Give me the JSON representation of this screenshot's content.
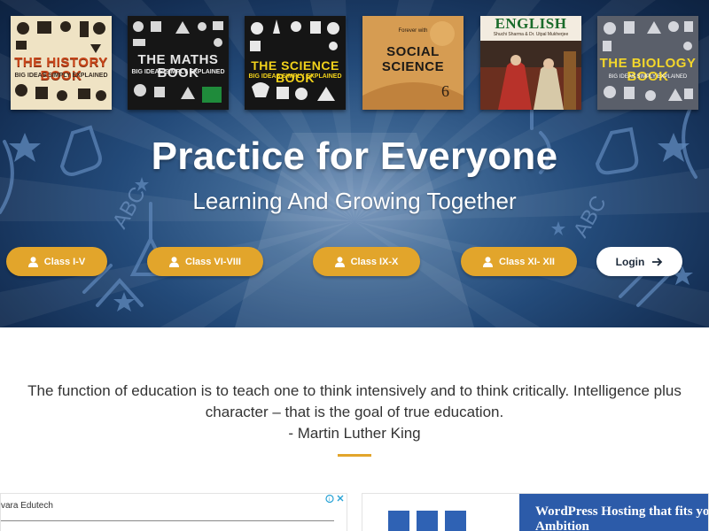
{
  "books": [
    {
      "title": "THE HISTORY BOOK",
      "subtitle": "BIG IDEAS SIMPLY EXPLAINED"
    },
    {
      "title": "THE MATHS BOOK",
      "subtitle": "BIG IDEAS SIMPLY EXPLAINED"
    },
    {
      "title": "THE SCIENCE BOOK",
      "subtitle": "BIG IDEAS SIMPLY EXPLAINED"
    },
    {
      "title": "SOCIAL SCIENCE",
      "subtitle": "Forever with",
      "number": "6"
    },
    {
      "title": "ENGLISH",
      "subtitle": "Shuchi Sharma & Dr. Utpal Mukherjee"
    },
    {
      "title": "THE BIOLOGY BOOK",
      "subtitle": "BIG IDEAS SIMPLY EXPLAINED"
    }
  ],
  "hero": {
    "title": "Practice for Everyone",
    "subtitle": "Learning And Growing Together"
  },
  "class_buttons": [
    {
      "label": "Class I-V"
    },
    {
      "label": "Class VI-VIII"
    },
    {
      "label": "Class IX-X"
    },
    {
      "label": "Class XI- XII"
    }
  ],
  "login": {
    "label": "Login"
  },
  "quote": {
    "text": "The function of education is to teach one to think intensively and to think critically. Intelligence plus character – that is the goal of true education.",
    "author": "- Martin Luther King"
  },
  "ads": {
    "left_advertiser": "vara Edutech",
    "right_headline": "WordPress Hosting that fits your Ambition"
  },
  "colors": {
    "accent": "#e2a52b",
    "hero_dark": "#132d52",
    "hero_light": "#6e8fb7",
    "text": "#333333"
  }
}
